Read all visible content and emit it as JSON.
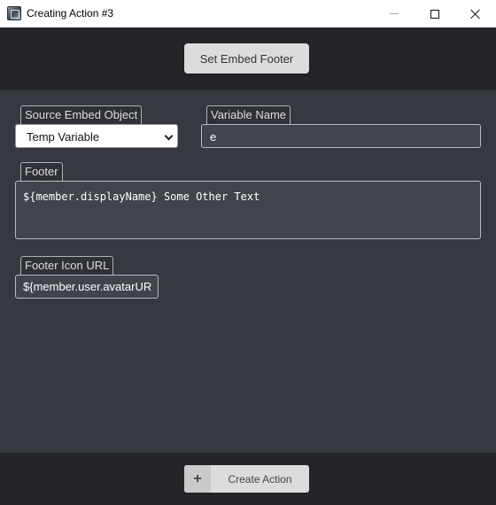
{
  "window": {
    "title": "Creating Action #3",
    "icon": "app-icon"
  },
  "header": {
    "action_button_label": "Set Embed Footer"
  },
  "form": {
    "source_embed": {
      "label": "Source Embed Object",
      "value": "Temp Variable"
    },
    "variable_name": {
      "label": "Variable Name",
      "value": "e"
    },
    "footer": {
      "label": "Footer",
      "value": "${member.displayName} Some Other Text"
    },
    "footer_icon_url": {
      "label": "Footer Icon URL",
      "value": "${member.user.avatarUR"
    }
  },
  "bottom": {
    "plus_icon": "+",
    "create_label": "Create Action"
  },
  "colors": {
    "titlebar": "#ffffff",
    "header_bg": "#242528",
    "body_bg": "#36393f",
    "field_bg": "#40444b"
  }
}
